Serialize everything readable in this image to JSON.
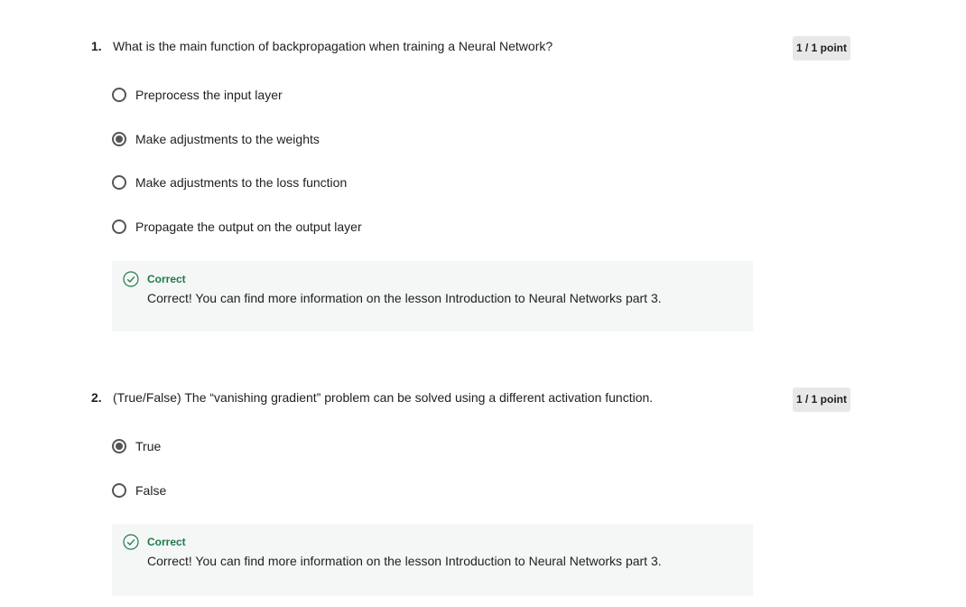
{
  "questions": [
    {
      "number": "1.",
      "text": "What is the main function of backpropagation when training a Neural Network?",
      "points": "1 / 1 point",
      "options": [
        {
          "label": "Preprocess the input layer",
          "selected": false
        },
        {
          "label": "Make adjustments to the weights",
          "selected": true
        },
        {
          "label": "Make adjustments to the loss function",
          "selected": false
        },
        {
          "label": "Propagate the output on the output layer",
          "selected": false
        }
      ],
      "feedback": {
        "title": "Correct",
        "text": "Correct! You can find more information on the lesson Introduction to Neural Networks part 3.",
        "icon": "check-circle-icon",
        "color": "#1f7a4d"
      }
    },
    {
      "number": "2.",
      "text": "(True/False) The “vanishing gradient” problem can be solved using a different activation function.",
      "points": "1 / 1 point",
      "options": [
        {
          "label": "True",
          "selected": true
        },
        {
          "label": "False",
          "selected": false
        }
      ],
      "feedback": {
        "title": "Correct",
        "text": "Correct! You can find more information on the lesson Introduction to Neural Networks part 3.",
        "icon": "check-circle-icon",
        "color": "#1f7a4d"
      }
    }
  ]
}
